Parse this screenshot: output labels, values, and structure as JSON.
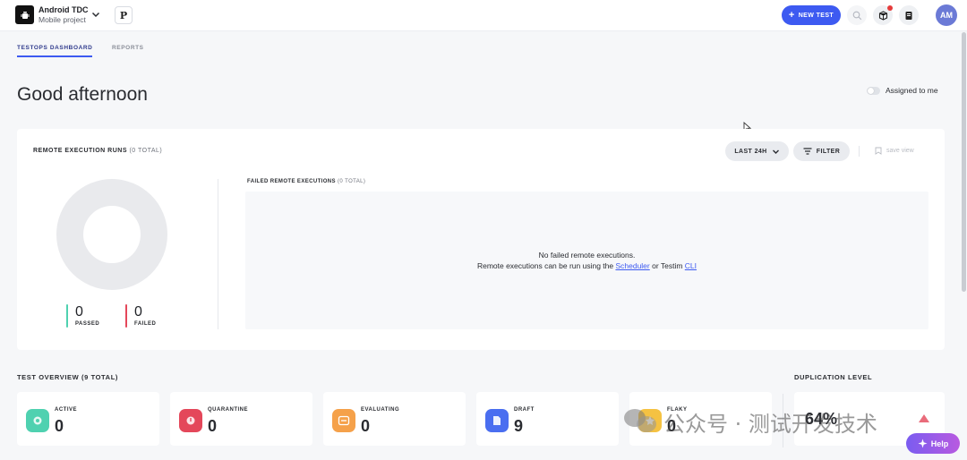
{
  "topbar": {
    "project_name": "Android TDC",
    "project_sub": "Mobile project",
    "project_badge": "P",
    "new_test": "NEW TEST",
    "avatar": "AM"
  },
  "tabs": [
    {
      "label": "TESTOPS DASHBOARD",
      "active": true
    },
    {
      "label": "REPORTS",
      "active": false
    }
  ],
  "greeting": "Good afternoon",
  "assigned_label": "Assigned to me",
  "remote": {
    "title": "REMOTE EXECUTION RUNS",
    "total": "(0 TOTAL)",
    "range_label": "LAST 24H",
    "filter_label": "FILTER",
    "save_view": "save view",
    "passed_value": "0",
    "passed_label": "PASSED",
    "failed_value": "0",
    "failed_label": "FAILED",
    "failed_title": "FAILED REMOTE EXECUTIONS",
    "failed_total": "(0 TOTAL)",
    "empty_line1": "No failed remote executions.",
    "empty_prefix": "Remote executions can be run using the ",
    "scheduler_link": "Scheduler",
    "empty_mid": " or Testim ",
    "cli_link": "CLI"
  },
  "overview": {
    "title": "TEST OVERVIEW (9 TOTAL)",
    "cards": [
      {
        "label": "ACTIVE",
        "value": "0",
        "color": "#4fd1b0"
      },
      {
        "label": "QUARANTINE",
        "value": "0",
        "color": "#e4475a"
      },
      {
        "label": "EVALUATING",
        "value": "0",
        "color": "#f5a14a"
      },
      {
        "label": "DRAFT",
        "value": "9",
        "color": "#4a6ef0"
      },
      {
        "label": "FLAKY",
        "value": "0",
        "color": "#f5c242"
      }
    ]
  },
  "duplication": {
    "title": "DUPLICATION LEVEL",
    "value": "64%"
  },
  "help_label": "Help",
  "watermark": "公众号 · 测试开发技术",
  "colors": {
    "accent": "#3d5af1",
    "passed": "#4fd1b0",
    "failed": "#e4475a"
  }
}
